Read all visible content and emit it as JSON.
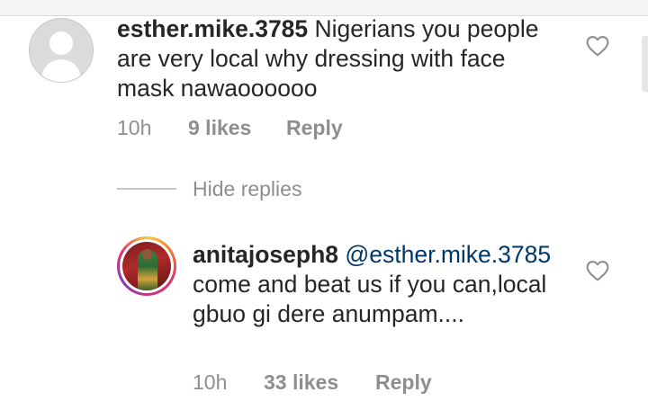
{
  "comments": [
    {
      "username": "esther.mike.3785",
      "text": "Nigerians you people are very local why dressing with face mask nawaoooooo",
      "time": "10h",
      "likes": "9 likes",
      "reply_label": "Reply",
      "avatar_icon": "default-profile-avatar",
      "like_icon": "heart-outline-icon"
    }
  ],
  "replies_toggle": {
    "label": "Hide replies"
  },
  "replies": [
    {
      "username": "anitajoseph8",
      "mention": "@esther.mike.3785",
      "text": "come and beat us if you can,local gbuo gi dere anumpam....",
      "time": "10h",
      "likes": "33 likes",
      "reply_label": "Reply",
      "avatar_icon": "profile-photo-avatar-story-ring",
      "like_icon": "heart-outline-icon"
    }
  ],
  "colors": {
    "text": "#262626",
    "secondary": "#8e8e8e",
    "mention": "#00376b",
    "story_ring": [
      "#fdc830",
      "#f37335",
      "#e1306c",
      "#c13584",
      "#833ab4"
    ]
  }
}
